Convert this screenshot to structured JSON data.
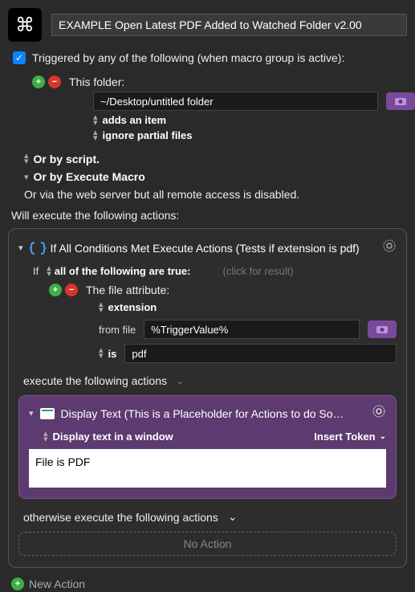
{
  "header": {
    "icon_glyph": "⌘",
    "title": "EXAMPLE Open Latest PDF Added to Watched Folder v2.00"
  },
  "trigger": {
    "checkbox_checked": true,
    "label": "Triggered by any of the following (when macro group is active):",
    "folder_label": "This folder:",
    "folder_path": "~/Desktop/untitled folder",
    "adds_item": "adds an item",
    "ignore_partial": "ignore partial files",
    "or_script": "Or by script.",
    "or_execute_macro": "Or by Execute Macro",
    "or_web": "Or via the web server but all remote access is disabled."
  },
  "section_label": "Will execute the following actions:",
  "if_action": {
    "title": "If All Conditions Met Execute Actions (Tests if extension is pdf)",
    "if_label": "If",
    "all_following": "all of the following are true:",
    "click_hint": "(click for result)",
    "file_attr_label": "The file attribute:",
    "extension_label": "extension",
    "from_file_label": "from file",
    "from_file_value": "%TriggerValue%",
    "is_label": "is",
    "is_value": "pdf",
    "execute_label": "execute the following actions",
    "otherwise_label": "otherwise execute the following actions",
    "no_action_label": "No Action"
  },
  "display_action": {
    "title": "Display Text (This is a Placeholder for Actions to do So…",
    "mode_label": "Display text in a window",
    "insert_token": "Insert Token",
    "text_value": "File is PDF"
  },
  "footer": {
    "new_action": "New Action"
  }
}
